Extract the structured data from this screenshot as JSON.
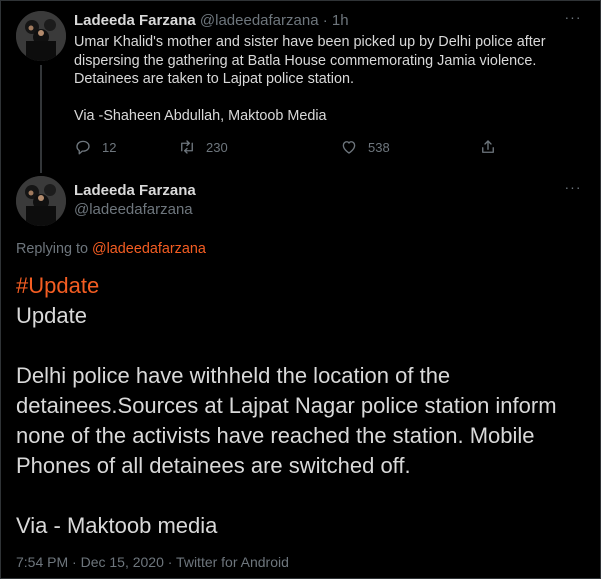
{
  "parent_tweet": {
    "author_name": "Ladeeda Farzana",
    "author_handle": "@ladeedafarzana",
    "separator": "·",
    "time": "1h",
    "body_lines": [
      "Umar Khalid's mother and sister have been picked up by Delhi police after",
      "dispersing the gathering at Batla House commemorating Jamia violence.",
      "Detainees are taken to Lajpat police station."
    ],
    "via": "Via -Shaheen Abdullah, Maktoob Media",
    "reply_count": "12",
    "retweet_count": "230",
    "like_count": "538",
    "more": "···"
  },
  "focused_tweet": {
    "author_name": "Ladeeda Farzana",
    "author_handle": "@ladeedafarzana",
    "more": "···",
    "replying_prefix": "Replying to",
    "replying_mention": "@ladeedafarzana",
    "hashtag": "#Update",
    "title": "Update",
    "body_lines": [
      "Delhi police have withheld the location of the",
      "detainees.Sources at Lajpat Nagar police station inform",
      "none of the activists have reached the station. Mobile",
      "Phones of all detainees are switched off."
    ],
    "via": "Via - Maktoob media",
    "timestamp": "7:54 PM · Dec 15, 2020 · Twitter for Android"
  },
  "colors": {
    "background": "#000000",
    "text": "#d9d9d9",
    "muted": "#6e767d",
    "accent": "#f45d22"
  },
  "icons": [
    "avatar",
    "more-icon",
    "reply-icon",
    "retweet-icon",
    "like-icon",
    "share-icon"
  ]
}
